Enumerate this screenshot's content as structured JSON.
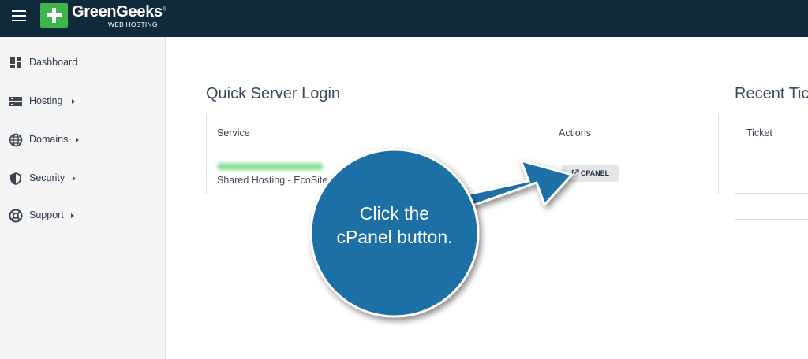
{
  "header": {
    "logo_name": "GreenGeeks",
    "logo_registered": "®",
    "logo_sub": "WEB HOSTING"
  },
  "sidebar": {
    "items": [
      {
        "label": "Dashboard",
        "icon": "dashboard-icon"
      },
      {
        "label": "Hosting",
        "icon": "server-icon"
      },
      {
        "label": "Domains",
        "icon": "globe-icon"
      },
      {
        "label": "Security",
        "icon": "shield-icon"
      },
      {
        "label": "Support",
        "icon": "lifebuoy-icon"
      }
    ]
  },
  "quick_login": {
    "title": "Quick Server Login",
    "columns": [
      "Service",
      "Actions"
    ],
    "rows": [
      {
        "plan": "Shared Hosting - EcoSite P",
        "action_label": "CPANEL"
      }
    ]
  },
  "recent_tickets": {
    "title": "Recent Tic",
    "columns": [
      "Ticket"
    ]
  },
  "callout": {
    "text_line1": "Click the",
    "text_line2": "cPanel button."
  },
  "colors": {
    "topbar": "#0f2a3b",
    "brand_green": "#3db54a",
    "callout_blue": "#1b6fa6"
  }
}
